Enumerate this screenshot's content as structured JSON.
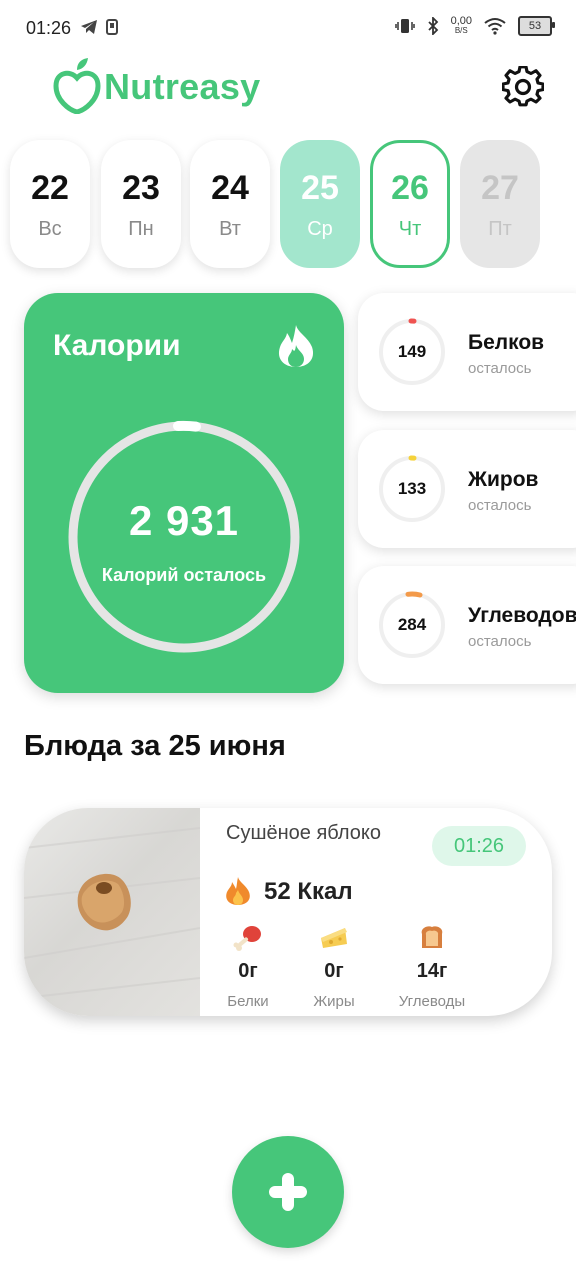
{
  "status_bar": {
    "time": "01:26",
    "net_speed": "0,00",
    "net_unit": "B/S",
    "battery": "53"
  },
  "header": {
    "app_name": "Nutreasy"
  },
  "dates": [
    {
      "num": "22",
      "weekday": "Вс",
      "state": "normal"
    },
    {
      "num": "23",
      "weekday": "Пн",
      "state": "normal"
    },
    {
      "num": "24",
      "weekday": "Вт",
      "state": "normal"
    },
    {
      "num": "25",
      "weekday": "Ср",
      "state": "selected"
    },
    {
      "num": "26",
      "weekday": "Чт",
      "state": "today"
    },
    {
      "num": "27",
      "weekday": "Пт",
      "state": "future"
    }
  ],
  "calories": {
    "title": "Калории",
    "value": "2 931",
    "label": "Калорий осталось"
  },
  "macros": [
    {
      "value": "149",
      "name": "Белков",
      "sub": "осталось",
      "color": "#ef5350"
    },
    {
      "value": "133",
      "name": "Жиров",
      "sub": "осталось",
      "color": "#f5d23a"
    },
    {
      "value": "284",
      "name": "Углеводов",
      "sub": "осталось",
      "color": "#f39a4a"
    }
  ],
  "section_title": "Блюда за 25 июня",
  "meal": {
    "name": "Сушёное яблоко",
    "time": "01:26",
    "kcal": "52 Ккал",
    "nutrients": [
      {
        "icon": "drumstick-icon",
        "value": "0г",
        "label": "Белки"
      },
      {
        "icon": "cheese-icon",
        "value": "0г",
        "label": "Жиры"
      },
      {
        "icon": "bread-icon",
        "value": "14г",
        "label": "Углеводы"
      }
    ]
  },
  "colors": {
    "accent": "#46c67a",
    "selected_day": "#a3e6cd",
    "time_chip": "#dff7ea"
  }
}
